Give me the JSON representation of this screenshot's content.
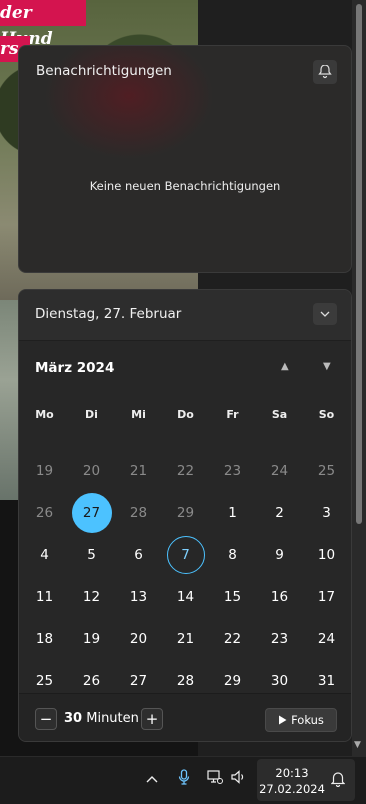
{
  "wallpaper": {
    "headline_1": "der Hund",
    "headline_2": "rs."
  },
  "notifications": {
    "title": "Benachrichtigungen",
    "empty_text": "Keine neuen Benachrichtigungen",
    "dnd_icon": "focus-assist-icon"
  },
  "calendar": {
    "selected_date": "Dienstag, 27. Februar",
    "month_title": "März 2024",
    "weekdays": [
      "Mo",
      "Di",
      "Mi",
      "Do",
      "Fr",
      "Sa",
      "So"
    ],
    "weeks": [
      [
        {
          "d": "19",
          "dim": true
        },
        {
          "d": "20",
          "dim": true
        },
        {
          "d": "21",
          "dim": true
        },
        {
          "d": "22",
          "dim": true
        },
        {
          "d": "23",
          "dim": true
        },
        {
          "d": "24",
          "dim": true
        },
        {
          "d": "25",
          "dim": true
        }
      ],
      [
        {
          "d": "26",
          "dim": true
        },
        {
          "d": "27",
          "dim": false,
          "today": true
        },
        {
          "d": "28",
          "dim": true
        },
        {
          "d": "29",
          "dim": true
        },
        {
          "d": "1"
        },
        {
          "d": "2"
        },
        {
          "d": "3"
        }
      ],
      [
        {
          "d": "4"
        },
        {
          "d": "5"
        },
        {
          "d": "6"
        },
        {
          "d": "7",
          "selected": true
        },
        {
          "d": "8"
        },
        {
          "d": "9"
        },
        {
          "d": "10"
        }
      ],
      [
        {
          "d": "11"
        },
        {
          "d": "12"
        },
        {
          "d": "13"
        },
        {
          "d": "14"
        },
        {
          "d": "15"
        },
        {
          "d": "16"
        },
        {
          "d": "17"
        }
      ],
      [
        {
          "d": "18"
        },
        {
          "d": "19"
        },
        {
          "d": "20"
        },
        {
          "d": "21"
        },
        {
          "d": "22"
        },
        {
          "d": "23"
        },
        {
          "d": "24"
        }
      ],
      [
        {
          "d": "25"
        },
        {
          "d": "26"
        },
        {
          "d": "27"
        },
        {
          "d": "28"
        },
        {
          "d": "29"
        },
        {
          "d": "30"
        },
        {
          "d": "31"
        }
      ]
    ],
    "accent": "#4cc2ff"
  },
  "focus": {
    "minus_label": "−",
    "plus_label": "+",
    "minutes_value": "30",
    "minutes_unit": "Minuten",
    "focus_label": "Fokus"
  },
  "taskbar": {
    "time": "20:13",
    "date": "27.02.2024"
  }
}
